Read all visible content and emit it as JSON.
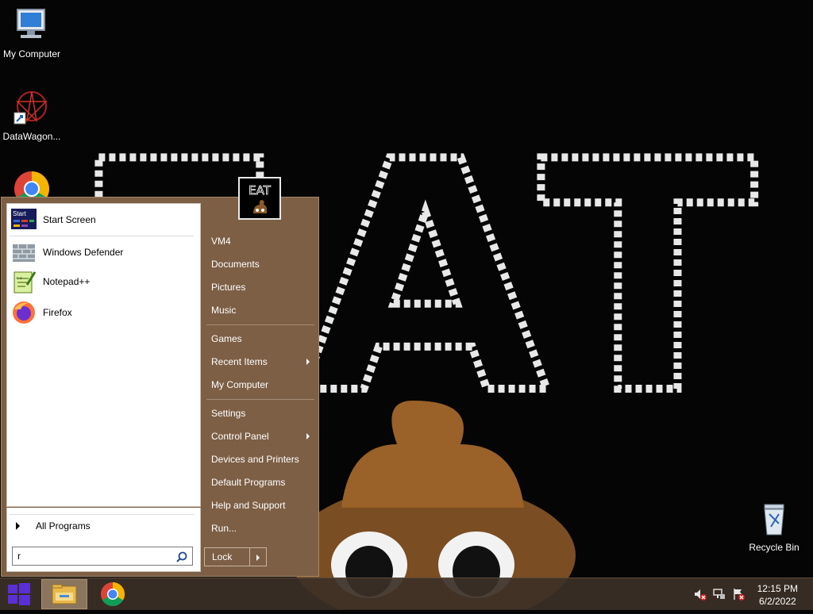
{
  "desktop": {
    "icons": [
      {
        "label": "My Computer"
      },
      {
        "label": "DataWagon..."
      },
      {
        "label": "Recycle Bin"
      }
    ]
  },
  "wallpaper": {
    "text": "EAT"
  },
  "start_menu": {
    "user_picture_text": "EAT",
    "pinned": [
      {
        "label": "Start Screen",
        "icon_badge": "Start",
        "icon": "start-screen-icon"
      },
      {
        "label": "Windows Defender",
        "icon": "windows-defender-icon"
      },
      {
        "label": "Notepad++",
        "icon": "notepad-plus-plus-icon"
      },
      {
        "label": "Firefox",
        "icon": "firefox-icon"
      }
    ],
    "all_programs_label": "All Programs",
    "search": {
      "value": "r",
      "placeholder": ""
    },
    "right_items": [
      {
        "label": "VM4"
      },
      {
        "label": "Documents"
      },
      {
        "label": "Pictures"
      },
      {
        "label": "Music"
      },
      {
        "label": "Games"
      },
      {
        "label": "Recent Items",
        "submenu": true
      },
      {
        "label": "My Computer"
      },
      {
        "label": "Settings"
      },
      {
        "label": "Control Panel",
        "submenu": true
      },
      {
        "label": "Devices and Printers"
      },
      {
        "label": "Default Programs"
      },
      {
        "label": "Help and Support"
      },
      {
        "label": "Run..."
      }
    ],
    "lock_label": "Lock"
  },
  "taskbar": {
    "clock_time": "12:15 PM",
    "clock_date": "6/2/2022",
    "tray_icons": [
      "volume-muted-icon",
      "network-icon",
      "action-center-icon"
    ]
  },
  "colors": {
    "menu_brown": "#7d5f45",
    "taskbar": "#3c3026",
    "windows_blue": "#5a2fd6"
  }
}
